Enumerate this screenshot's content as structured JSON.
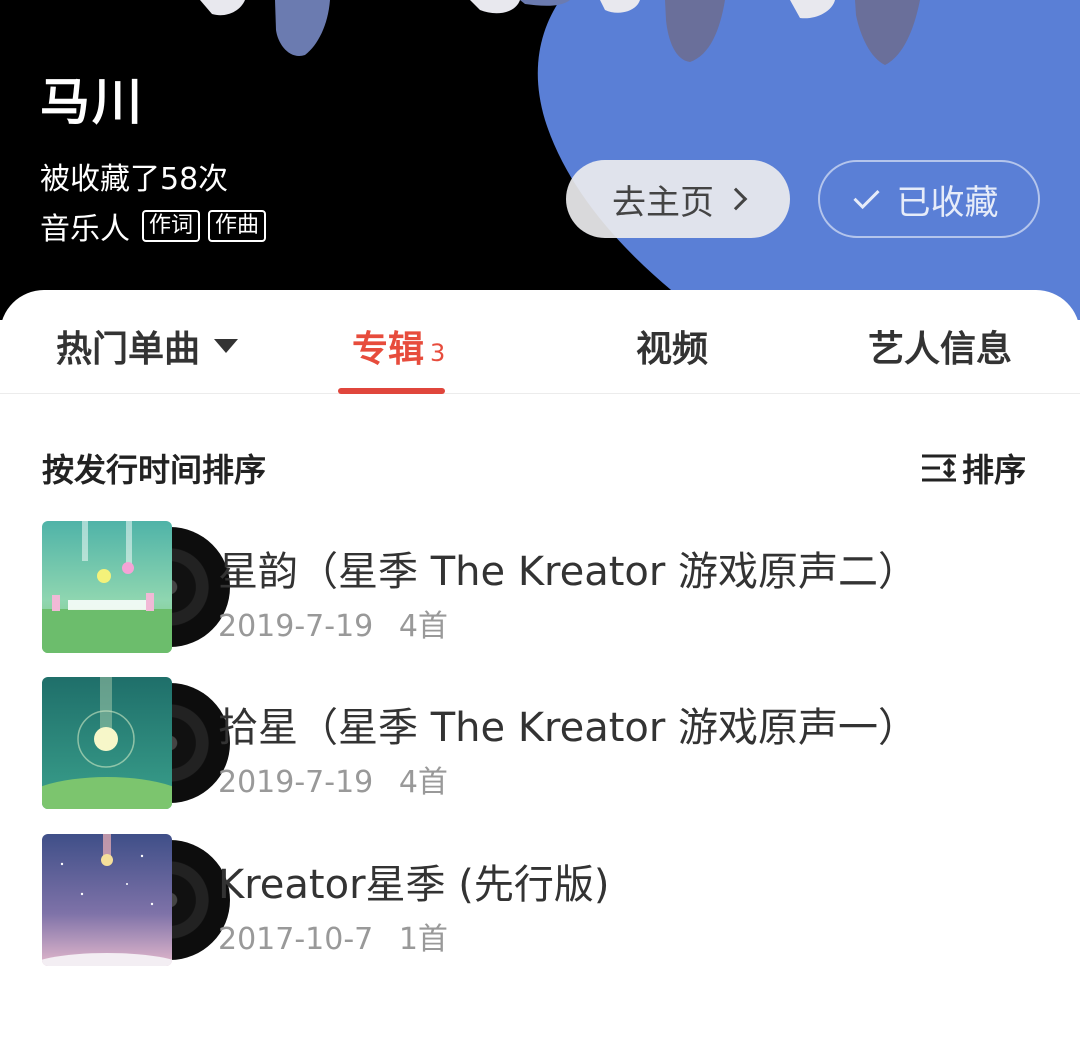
{
  "artist": {
    "name": "马川",
    "favorited": "被收藏了58次",
    "role": "音乐人",
    "tags": [
      "作词",
      "作曲"
    ]
  },
  "header_buttons": {
    "home": "去主页",
    "fav": "已收藏"
  },
  "tabs": [
    {
      "label": "热门单曲"
    },
    {
      "label": "专辑",
      "count": "3"
    },
    {
      "label": "视频"
    },
    {
      "label": "艺人信息"
    }
  ],
  "sort": {
    "label": "按发行时间排序",
    "button": "排序"
  },
  "albums": [
    {
      "title": "星韵（星季 The Kreator 游戏原声二）",
      "date": "2019-7-19",
      "tracks": "4首"
    },
    {
      "title": "拾星（星季 The Kreator 游戏原声一）",
      "date": "2019-7-19",
      "tracks": "4首"
    },
    {
      "title": "Kreator星季 (先行版)",
      "date": "2017-10-7",
      "tracks": "1首"
    }
  ],
  "colors": {
    "accent": "#e0463c",
    "header_blue": "#5a7fd6"
  }
}
